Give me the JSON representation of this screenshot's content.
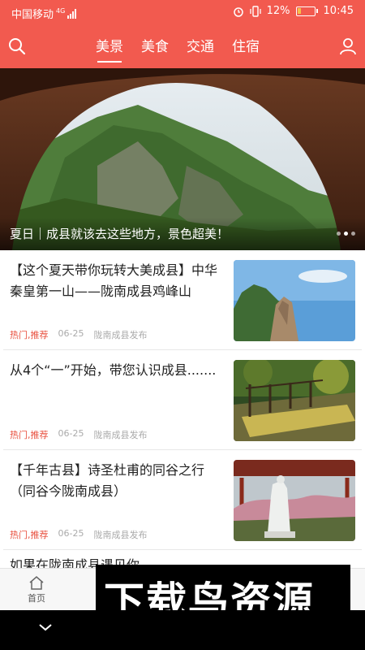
{
  "status_bar": {
    "carrier": "中国移动",
    "network": "4G",
    "battery": "12%",
    "time": "10:45"
  },
  "header": {
    "tabs": [
      {
        "label": "美景",
        "active": true
      },
      {
        "label": "美食",
        "active": false
      },
      {
        "label": "交通",
        "active": false
      },
      {
        "label": "住宿",
        "active": false
      }
    ],
    "icons": [
      "search-icon",
      "user-icon"
    ],
    "accent_color": "#f25a4f"
  },
  "banner": {
    "caption": "夏日｜成县就该去这些地方，景色超美！",
    "page_count": 3,
    "active_index": 1
  },
  "articles": [
    {
      "title": "【这个夏天带你玩转大美成县】中华秦皇第一山——陇南成县鸡峰山",
      "tag": "热门,推荐",
      "date": "06-25",
      "source": "陇南成县发布"
    },
    {
      "title": "从4个“一”开始，带您认识成县.......",
      "tag": "热门,推荐",
      "date": "06-25",
      "source": "陇南成县发布"
    },
    {
      "title": "【千年古县】诗圣杜甫的同谷之行（同谷今陇南成县）",
      "tag": "热门,推荐",
      "date": "06-25",
      "source": "陇南成县发布"
    },
    {
      "title": "如果在陇南成县遇见你",
      "tag": "",
      "date": "",
      "source": ""
    }
  ],
  "bottom_nav": {
    "home_label": "首页"
  },
  "watermark": {
    "text": "下载鸟资源"
  }
}
